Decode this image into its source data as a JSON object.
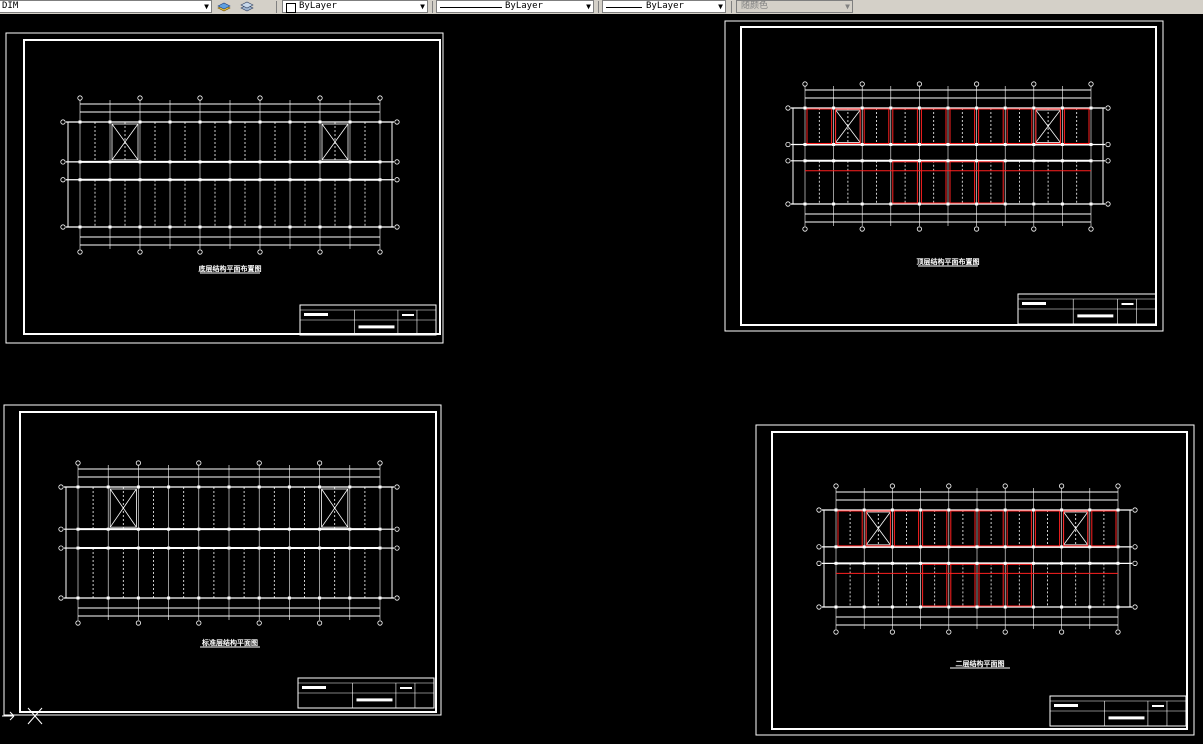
{
  "toolbar": {
    "layer_value": "DIM",
    "color_value": "ByLayer",
    "linetype_value": "ByLayer",
    "lineweight_value": "ByLayer",
    "plotstyle_value": "随颜色"
  },
  "drawings": [
    {
      "title": "底层结构平面布置图"
    },
    {
      "title": "顶层结构平面布置图"
    },
    {
      "title": "标准层结构平面图"
    },
    {
      "title": "二层结构平面图"
    }
  ],
  "colors": {
    "background": "#000000",
    "lines": "#ffffff",
    "beams": "#ff2020",
    "toolbar": "#d4d0c8"
  }
}
